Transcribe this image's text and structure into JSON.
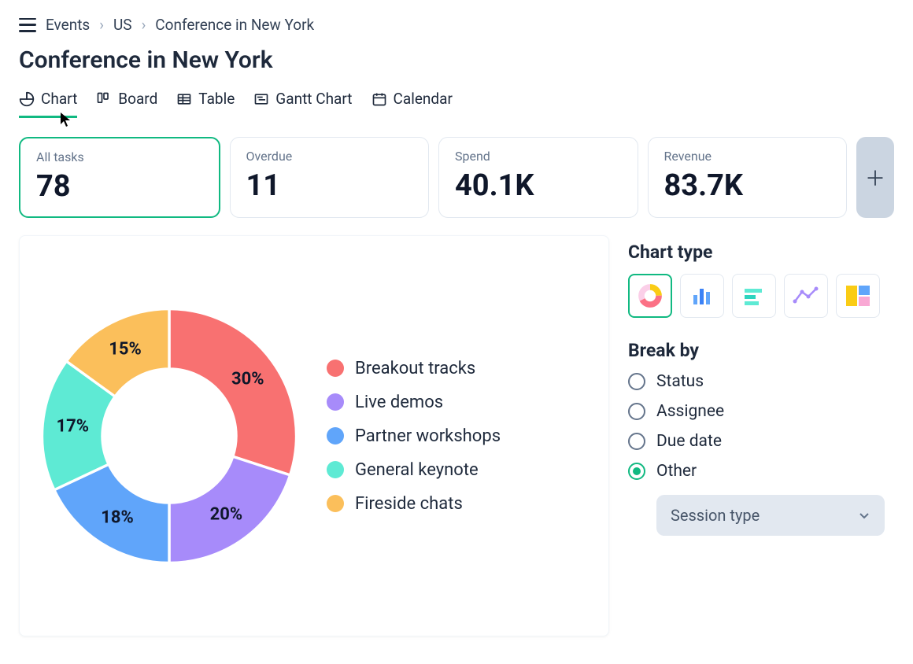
{
  "breadcrumb": {
    "items": [
      "Events",
      "US",
      "Conference in New York"
    ]
  },
  "page_title": "Conference in New York",
  "tabs": [
    {
      "id": "chart",
      "label": "Chart",
      "active": true
    },
    {
      "id": "board",
      "label": "Board",
      "active": false
    },
    {
      "id": "table",
      "label": "Table",
      "active": false
    },
    {
      "id": "gantt",
      "label": "Gantt Chart",
      "active": false
    },
    {
      "id": "calendar",
      "label": "Calendar",
      "active": false
    }
  ],
  "stats": [
    {
      "label": "All tasks",
      "value": "78",
      "selected": true
    },
    {
      "label": "Overdue",
      "value": "11",
      "selected": false
    },
    {
      "label": "Spend",
      "value": "40.1K",
      "selected": false
    },
    {
      "label": "Revenue",
      "value": "83.7K",
      "selected": false
    }
  ],
  "chart_data": {
    "type": "pie",
    "categories": [
      "Breakout tracks",
      "Live demos",
      "Partner workshops",
      "General keynote",
      "Fireside chats"
    ],
    "values": [
      30,
      20,
      18,
      17,
      15
    ],
    "colors": [
      "#f87171",
      "#a78bfa",
      "#60a5fa",
      "#5eead4",
      "#fbbf5b"
    ],
    "unit": "%",
    "title": ""
  },
  "chart_type": {
    "title": "Chart type",
    "options": [
      {
        "id": "donut",
        "selected": true
      },
      {
        "id": "bar-vertical",
        "selected": false
      },
      {
        "id": "bar-horizontal",
        "selected": false
      },
      {
        "id": "line",
        "selected": false
      },
      {
        "id": "treemap",
        "selected": false
      }
    ]
  },
  "break_by": {
    "title": "Break by",
    "options": [
      {
        "label": "Status",
        "selected": false
      },
      {
        "label": "Assignee",
        "selected": false
      },
      {
        "label": "Due date",
        "selected": false
      },
      {
        "label": "Other",
        "selected": true
      }
    ],
    "other_select": "Session type"
  }
}
